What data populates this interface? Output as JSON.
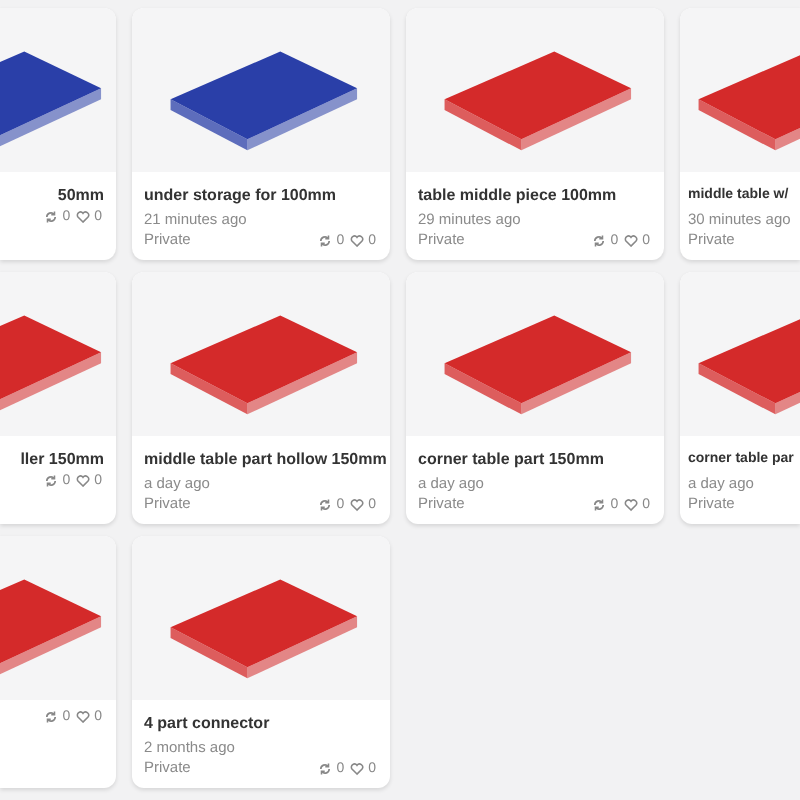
{
  "cards": [
    {
      "title": "50mm",
      "remixes": "0",
      "likes": "0",
      "color": "#2a3fa8"
    },
    {
      "title": "under storage for 100mm",
      "time": "21 minutes ago",
      "visibility": "Private",
      "remixes": "0",
      "likes": "0",
      "color": "#2a3fa8"
    },
    {
      "title": "table middle piece 100mm",
      "time": "29 minutes ago",
      "visibility": "Private",
      "remixes": "0",
      "likes": "0",
      "color": "#d42a2a"
    },
    {
      "title": "middle table w/",
      "time": "30 minutes ago",
      "visibility": "Private",
      "color": "#d42a2a"
    },
    {
      "title": "ller 150mm",
      "remixes": "0",
      "likes": "0",
      "color": "#d42a2a"
    },
    {
      "title": "middle table part hollow 150mm",
      "time": "a day ago",
      "visibility": "Private",
      "remixes": "0",
      "likes": "0",
      "color": "#d42a2a"
    },
    {
      "title": "corner table part 150mm",
      "time": "a day ago",
      "visibility": "Private",
      "remixes": "0",
      "likes": "0",
      "color": "#d42a2a"
    },
    {
      "title": "corner table par",
      "time": "a day ago",
      "visibility": "Private",
      "color": "#d42a2a"
    },
    {
      "remixes": "0",
      "likes": "0",
      "color": "#d42a2a"
    },
    {
      "title": "4 part connector",
      "time": "2 months ago",
      "visibility": "Private",
      "remixes": "0",
      "likes": "0",
      "color": "#d42a2a"
    }
  ]
}
